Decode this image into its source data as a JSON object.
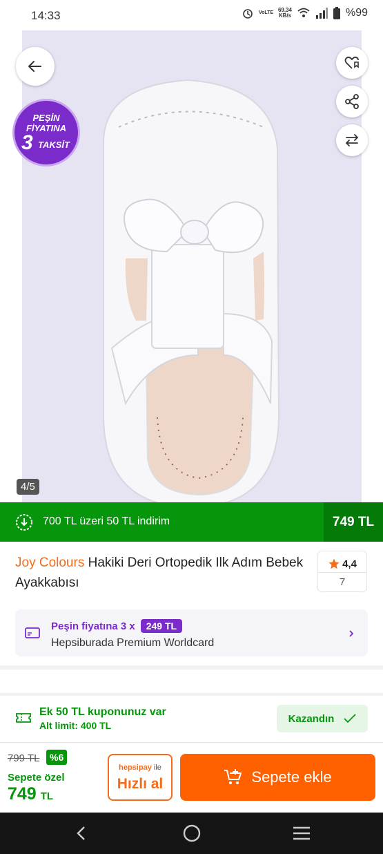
{
  "status_bar": {
    "time": "14:33",
    "volte": "VoLTE",
    "net_speed": "69,34",
    "net_unit": "KB/s",
    "battery": "%99"
  },
  "gallery": {
    "promo_line1": "PEŞİN",
    "promo_line2": "FİYATINA",
    "promo_number": "3",
    "promo_word": "TAKSİT",
    "counter": "4/5"
  },
  "discount_bar": {
    "text": "700 TL üzeri 50 TL indirim",
    "price": "749 TL"
  },
  "product": {
    "brand": "Joy Colours",
    "name": " Hakiki Deri Ortopedik Ilk Adım Bebek Ayakkabısı",
    "rating": "4,4",
    "review_count": "7"
  },
  "premium": {
    "line1": "Peşin fiyatına 3 x",
    "installment": "249 TL",
    "line2": "Hepsiburada Premium Worldcard"
  },
  "coupon": {
    "title": "Ek 50 TL kuponunuz var",
    "subtitle": "Alt limit: 400 TL",
    "status": "Kazandın"
  },
  "buy_bar": {
    "old_price": "799 TL",
    "discount_pct": "%6",
    "special_label": "Sepete özel",
    "price": "749",
    "currency": "TL",
    "quick_brand": "hepsipay",
    "quick_ile": " ile",
    "quick_label": "Hızlı al",
    "add_to_cart": "Sepete ekle"
  },
  "colors": {
    "brand_orange": "#ff6000",
    "green": "#05960c",
    "purple": "#7b2bc9"
  }
}
